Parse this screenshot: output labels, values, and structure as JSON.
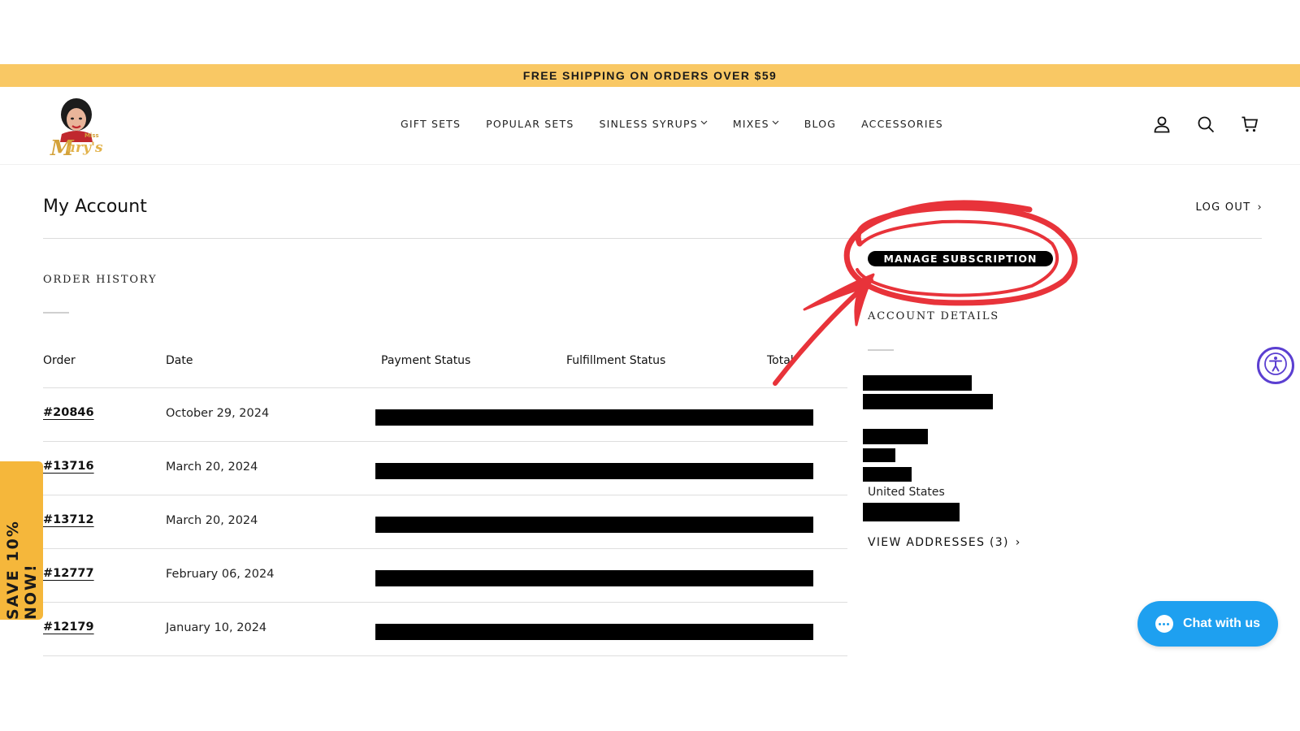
{
  "announcement": {
    "text": "FREE SHIPPING ON ORDERS OVER $59"
  },
  "header": {
    "logo_alt": "Miss Mary's",
    "nav": [
      {
        "label": "GIFT SETS",
        "dropdown": false
      },
      {
        "label": "POPULAR SETS",
        "dropdown": false
      },
      {
        "label": "SINLESS SYRUPS",
        "dropdown": true
      },
      {
        "label": "MIXES",
        "dropdown": true
      },
      {
        "label": "BLOG",
        "dropdown": false
      },
      {
        "label": "ACCESSORIES",
        "dropdown": false
      }
    ],
    "icons": [
      "account-icon",
      "search-icon",
      "cart-icon"
    ]
  },
  "account": {
    "title": "My Account",
    "logout_label": "LOG OUT",
    "logout_chevron": "›"
  },
  "order_history": {
    "title": "ORDER HISTORY",
    "columns": [
      "Order",
      "Date",
      "Payment Status",
      "Fulfillment Status",
      "Total"
    ],
    "rows": [
      {
        "order": "#20846",
        "date": "October 29, 2024"
      },
      {
        "order": "#13716",
        "date": "March 20, 2024"
      },
      {
        "order": "#13712",
        "date": "March 20, 2024"
      },
      {
        "order": "#12777",
        "date": "February 06, 2024"
      },
      {
        "order": "#12179",
        "date": "January 10, 2024"
      }
    ]
  },
  "sidebar": {
    "manage_subscription": "MANAGE SUBSCRIPTION",
    "account_details_title": "ACCOUNT DETAILS",
    "country": "United States",
    "view_addresses": "VIEW ADDRESSES (3)",
    "view_addresses_chevron": "›"
  },
  "widgets": {
    "save_tab": "SAVE 10% NOW!",
    "chat_label": "Chat with us"
  },
  "colors": {
    "announcement_bg": "#f9c864",
    "save_tab_bg": "#f5b73b",
    "chat_bg": "#1ea0f0",
    "annotation_red": "#e8333a",
    "a11y_purple": "#5b3fd1"
  }
}
